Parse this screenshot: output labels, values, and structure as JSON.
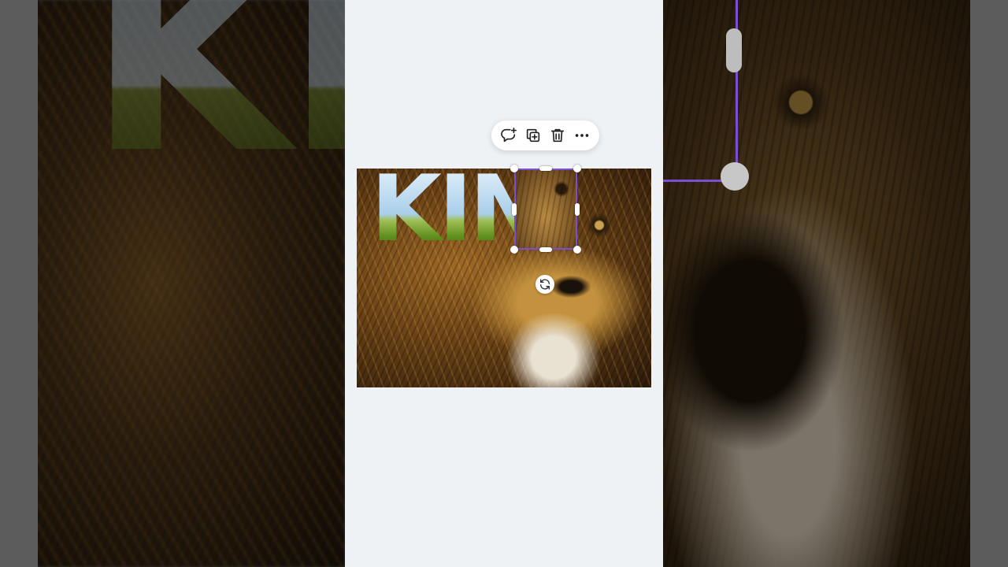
{
  "design": {
    "title_text": "KIN"
  },
  "toolbar": {
    "buttons": [
      {
        "name": "comment",
        "icon": "comment-plus-icon"
      },
      {
        "name": "duplicate",
        "icon": "duplicate-icon"
      },
      {
        "name": "delete",
        "icon": "trash-icon"
      },
      {
        "name": "more",
        "icon": "more-horizontal-icon"
      }
    ]
  },
  "colors": {
    "selection": "#7a4fd6",
    "canvas_background": "#eff2f5",
    "toolbar_background": "#ffffff"
  }
}
